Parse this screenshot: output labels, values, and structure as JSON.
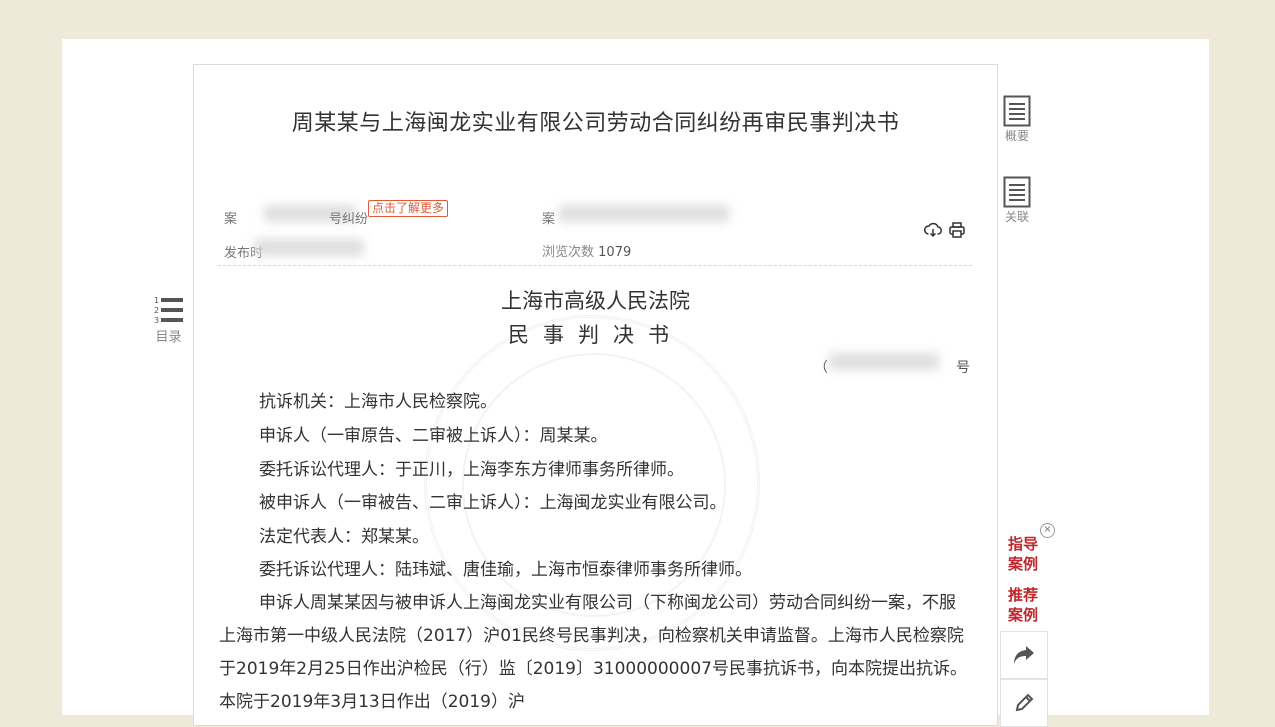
{
  "document": {
    "title": "周某某与上海闽龙实业有限公司劳动合同纠纷再审民事判决书",
    "case_label": "案",
    "case_suffix": "号纠纷",
    "learn_more": "点击了解更多",
    "meta2_label": "案",
    "meta3_label": "发布时",
    "views_label": "浏览次数",
    "views_count": "1079",
    "court": "上海市高级人民法院",
    "doc_type": "民事判决书",
    "doc_no_prefix": "（",
    "doc_no_suffix": "号",
    "paragraphs": [
      "抗诉机关：上海市人民检察院。",
      "申诉人（一审原告、二审被上诉人）：周某某。",
      "委托诉讼代理人：于正川，上海李东方律师事务所律师。",
      "被申诉人（一审被告、二审上诉人）：上海闽龙实业有限公司。",
      "法定代表人：郑某某。",
      "委托诉讼代理人：陆玮斌、唐佳瑜，上海市恒泰律师事务所律师。"
    ],
    "body": "申诉人周某某因与被申诉人上海闽龙实业有限公司（下称闽龙公司）劳动合同纠纷一案，不服上海市第一中级人民法院（2017）沪01民终号民事判决，向检察机关申请监督。上海市人民检察院于2019年2月25日作出沪检民（行）监〔2019〕31000000007号民事抗诉书，向本院提出抗诉。本院于2019年3月13日作出（2019）沪"
  },
  "sidebar_right": {
    "summary_label": "概要",
    "related_label": "关联"
  },
  "toc": {
    "label": "目录",
    "numbers": [
      "1",
      "2",
      "3"
    ]
  },
  "floating": {
    "guide_case": [
      "指导",
      "案例"
    ],
    "recommend_case": [
      "推荐",
      "案例"
    ],
    "close": "×"
  },
  "colors": {
    "background": "#efe9da",
    "accent_red": "#c0262c",
    "tag_red": "#e05a3a"
  },
  "icons": {
    "download": "download-icon",
    "print": "print-icon",
    "summary": "document-icon",
    "related": "document-list-icon",
    "toc": "numbered-list-icon",
    "share": "share-arrow-icon",
    "edit": "pencil-icon"
  }
}
